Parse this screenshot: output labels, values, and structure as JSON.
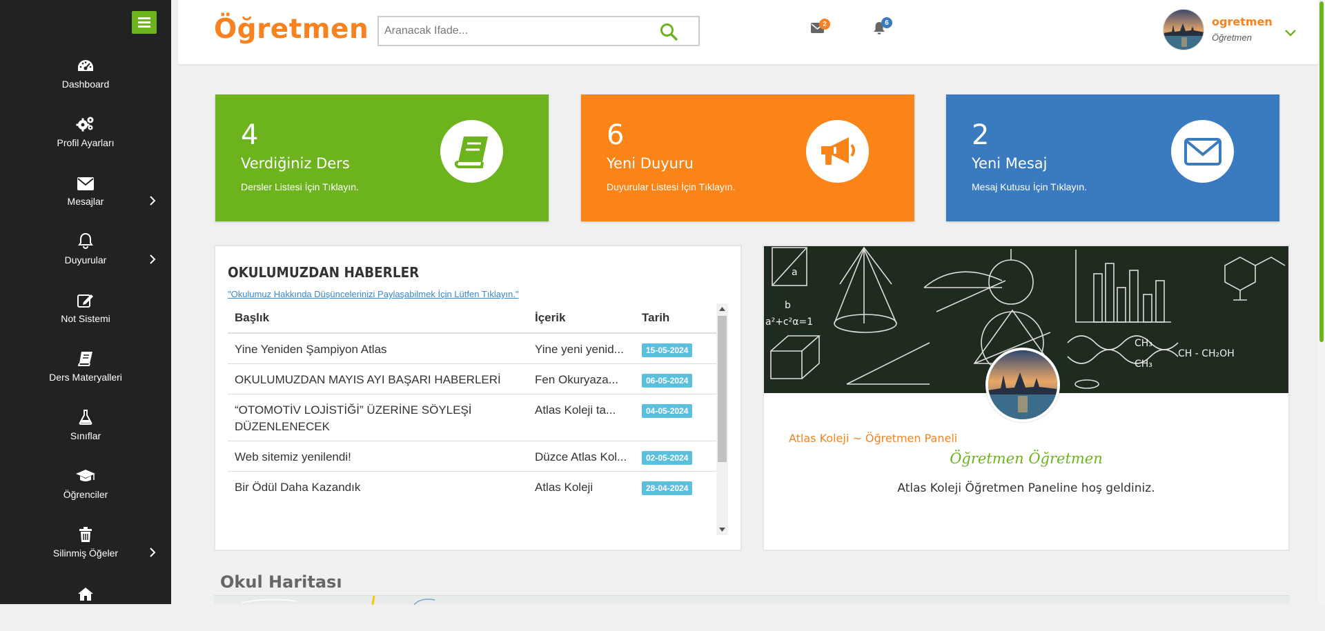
{
  "brand": "Öğretmen",
  "search": {
    "placeholder": "Aranacak İfade..."
  },
  "header": {
    "messages_count": "2",
    "notifications_count": "6",
    "username": "ogretmen",
    "role": "Öğretmen"
  },
  "sidebar": {
    "items": [
      {
        "label": "Dashboard",
        "icon": "dashboard-icon"
      },
      {
        "label": "Profil Ayarları",
        "icon": "gears-icon"
      },
      {
        "label": "Mesajlar",
        "icon": "envelope-icon"
      },
      {
        "label": "Duyurular",
        "icon": "bell-icon"
      },
      {
        "label": "Not Sistemi",
        "icon": "edit-icon"
      },
      {
        "label": "Ders Materyalleri",
        "icon": "book-icon"
      },
      {
        "label": "Sınıflar",
        "icon": "flask-icon"
      },
      {
        "label": "Öğrenciler",
        "icon": "graduation-cap-icon"
      },
      {
        "label": "Silinmiş Öğeler",
        "icon": "trash-icon"
      },
      {
        "label": "",
        "icon": "home-icon"
      }
    ]
  },
  "cards": [
    {
      "number": "4",
      "title": "Verdiğiniz Ders",
      "subtitle": "Dersler Listesi İçin Tıklayın.",
      "color": "#6cb31e",
      "icon": "book-icon"
    },
    {
      "number": "6",
      "title": "Yeni Duyuru",
      "subtitle": "Duyurular Listesi İçin Tıklayın.",
      "color": "#fa8418",
      "icon": "bullhorn-icon"
    },
    {
      "number": "2",
      "title": "Yeni Mesaj",
      "subtitle": "Mesaj Kutusu İçin Tıklayın.",
      "color": "#3a7bc0",
      "icon": "envelope-icon"
    }
  ],
  "news": {
    "title": "OKULUMUZDAN HABERLER",
    "link": "\"Okulumuz Hakkında Düşüncelerinizi Paylaşabilmek İçin Lütfen Tıklayın.\"",
    "columns": [
      "Başlık",
      "İçerik",
      "Tarih"
    ],
    "rows": [
      {
        "title": "Yine Yeniden Şampiyon Atlas",
        "content": "Yine yeni yenid...",
        "date": "15-05-2024"
      },
      {
        "title": "OKULUMUZDAN MAYIS AYI BAŞARI HABERLERİ",
        "content": "Fen Okuryaza...",
        "date": "06-05-2024"
      },
      {
        "title": "“OTOMOTİV LOJİSTİĞİ” ÜZERİNE SÖYLEŞİ DÜZENLENECEK",
        "content": "Atlas Koleji ta...",
        "date": "04-05-2024"
      },
      {
        "title": "Web sitemiz yenilendi!",
        "content": "Düzce Atlas Kol...",
        "date": "02-05-2024"
      },
      {
        "title": "Bir Ödül Daha Kazandık",
        "content": "Atlas Koleji",
        "date": "28-04-2024"
      }
    ]
  },
  "welcome": {
    "school": "Atlas Koleji ~ Öğretmen Paneli",
    "name": "Öğretmen Öğretmen",
    "message": "Atlas Koleji Öğretmen Paneline hoş geldiniz."
  },
  "map": {
    "title": "Okul Haritası"
  },
  "colors": {
    "green": "#6cb31e",
    "orange": "#f7821f",
    "blue": "#3a7bc0",
    "sidebar": "#222222",
    "date_badge": "#5bc0de"
  }
}
